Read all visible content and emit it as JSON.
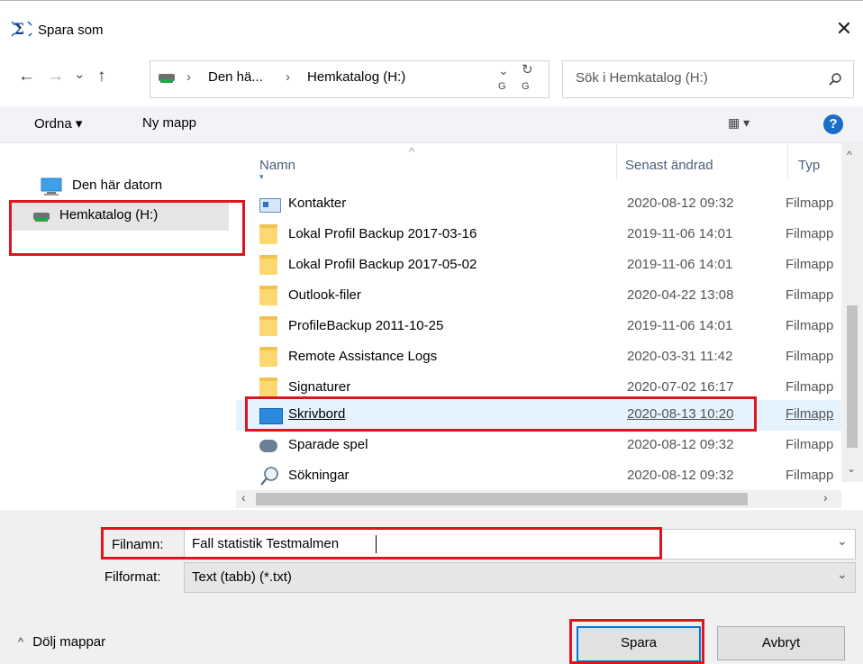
{
  "window": {
    "title": "Spara som",
    "close_icon": "close-icon"
  },
  "nav": {
    "back_icon": "←",
    "forward_icon": "→",
    "recent_icon": "⌄",
    "up_icon": "↑",
    "breadcrumb": [
      "Den hä...",
      "Hemkatalog (H:)"
    ],
    "sep": "›",
    "dropdown_chevron": "⌄",
    "refresh_icon": "↻",
    "refresh_fragments": [
      "G",
      "G"
    ]
  },
  "search": {
    "placeholder": "Sök i Hemkatalog (H:)"
  },
  "toolbar": {
    "organize": "Ordna ▾",
    "new_folder": "Ny mapp",
    "view_icon": "▦ ▾",
    "help": "?"
  },
  "navpane": {
    "items": [
      {
        "label": "Den här datorn"
      },
      {
        "label": "Hemkatalog (H:)"
      }
    ]
  },
  "columns": {
    "name": "Namn",
    "modified": "Senast ändrad",
    "type": "Typ"
  },
  "files": [
    {
      "name": "Kontakter",
      "date": "2020-08-12 09:32",
      "type": "Filmapp",
      "icon": "contacts-icon"
    },
    {
      "name": "Lokal Profil Backup 2017-03-16",
      "date": "2019-11-06 14:01",
      "type": "Filmapp",
      "icon": "folder-icon"
    },
    {
      "name": "Lokal Profil Backup 2017-05-02",
      "date": "2019-11-06 14:01",
      "type": "Filmapp",
      "icon": "folder-icon"
    },
    {
      "name": "Outlook-filer",
      "date": "2020-04-22 13:08",
      "type": "Filmapp",
      "icon": "folder-icon"
    },
    {
      "name": "ProfileBackup 2011-10-25",
      "date": "2019-11-06 14:01",
      "type": "Filmapp",
      "icon": "folder-icon"
    },
    {
      "name": "Remote Assistance Logs",
      "date": "2020-03-31 11:42",
      "type": "Filmapp",
      "icon": "folder-icon"
    },
    {
      "name": "Signaturer",
      "date": "2020-07-02 16:17",
      "type": "Filmapp",
      "icon": "folder-icon"
    },
    {
      "name": "Skrivbord",
      "date": "2020-08-13 10:20",
      "type": "Filmapp",
      "icon": "desktop-icon"
    },
    {
      "name": "Sparade spel",
      "date": "2020-08-12 09:32",
      "type": "Filmapp",
      "icon": "saved-games-icon"
    },
    {
      "name": "Sökningar",
      "date": "2020-08-12 09:32",
      "type": "Filmapp",
      "icon": "search-folder-icon"
    }
  ],
  "form": {
    "filename_label": "Filnamn:",
    "filename_value": "Fall statistik Testmalmen",
    "format_label": "Filformat:",
    "format_value": "Text (tabb) (*.txt)"
  },
  "footer": {
    "hide_folders": "Dölj mappar",
    "save": "Spara",
    "cancel": "Avbryt"
  },
  "colors": {
    "highlight": "#e0141e",
    "selected_row": "#e5f3ff",
    "accent": "#0078d7"
  }
}
